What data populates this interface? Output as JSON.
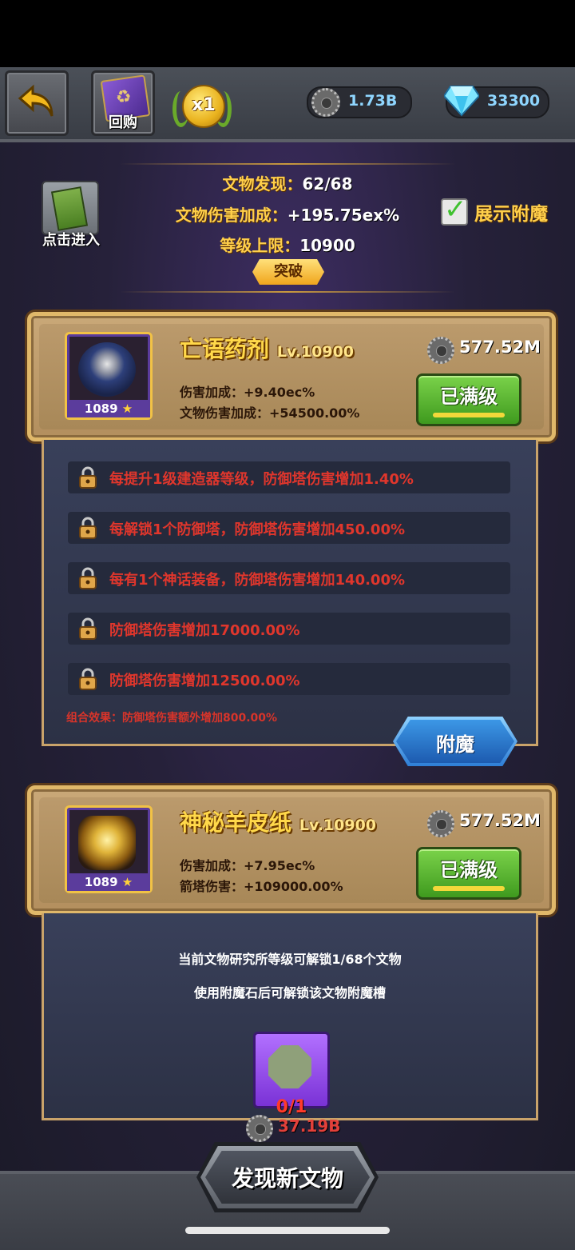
{
  "topbar": {
    "buyback_label": "回购",
    "multiplier": "x1",
    "gear_currency": "1.73B",
    "diamond_currency": "33300"
  },
  "header": {
    "entry_label": "点击进入",
    "found_label": "文物发现：",
    "found_value": "62/68",
    "damage_label": "文物伤害加成：",
    "damage_value": "+195.75ex%",
    "limit_label": "等级上限：",
    "limit_value": "10900",
    "breakthrough_label": "突破",
    "show_enchant_label": "展示附魔",
    "show_enchant_checked": true
  },
  "relics": [
    {
      "name": "亡语药剂",
      "level": "Lv.10900",
      "badge": "1089",
      "stat1_label": "伤害加成：",
      "stat1_value": "+9.40ec%",
      "stat2_label": "文物伤害加成：",
      "stat2_value": "+54500.00%",
      "cost": "577.52M",
      "button": "已满级"
    },
    {
      "name": "神秘羊皮纸",
      "level": "Lv.10900",
      "badge": "1089",
      "stat1_label": "伤害加成：",
      "stat1_value": "+7.95ec%",
      "stat2_label": "箭塔伤害：",
      "stat2_value": "+109000.00%",
      "cost": "577.52M",
      "button": "已满级"
    }
  ],
  "enchant": {
    "rows": [
      "每提升1级建造器等级，防御塔伤害增加1.40%",
      "每解锁1个防御塔，防御塔伤害增加450.00%",
      "每有1个神话装备，防御塔伤害增加140.00%",
      "防御塔伤害增加17000.00%",
      "防御塔伤害增加12500.00%"
    ],
    "combo": "组合效果：防御塔伤害额外增加800.00%",
    "button": "附魔"
  },
  "locked_panel": {
    "line1": "当前文物研究所等级可解锁1/68个文物",
    "line2": "使用附魔石后可解锁该文物附魔槽",
    "stone_count": "0/1"
  },
  "bottom": {
    "cost": "37.19B",
    "discover_label": "发现新文物"
  },
  "colors": {
    "gold_text": "#ffcf4a",
    "red_text": "#e0362c",
    "green_button": "#3f9a1e",
    "blue_button": "#2e7ed6"
  }
}
